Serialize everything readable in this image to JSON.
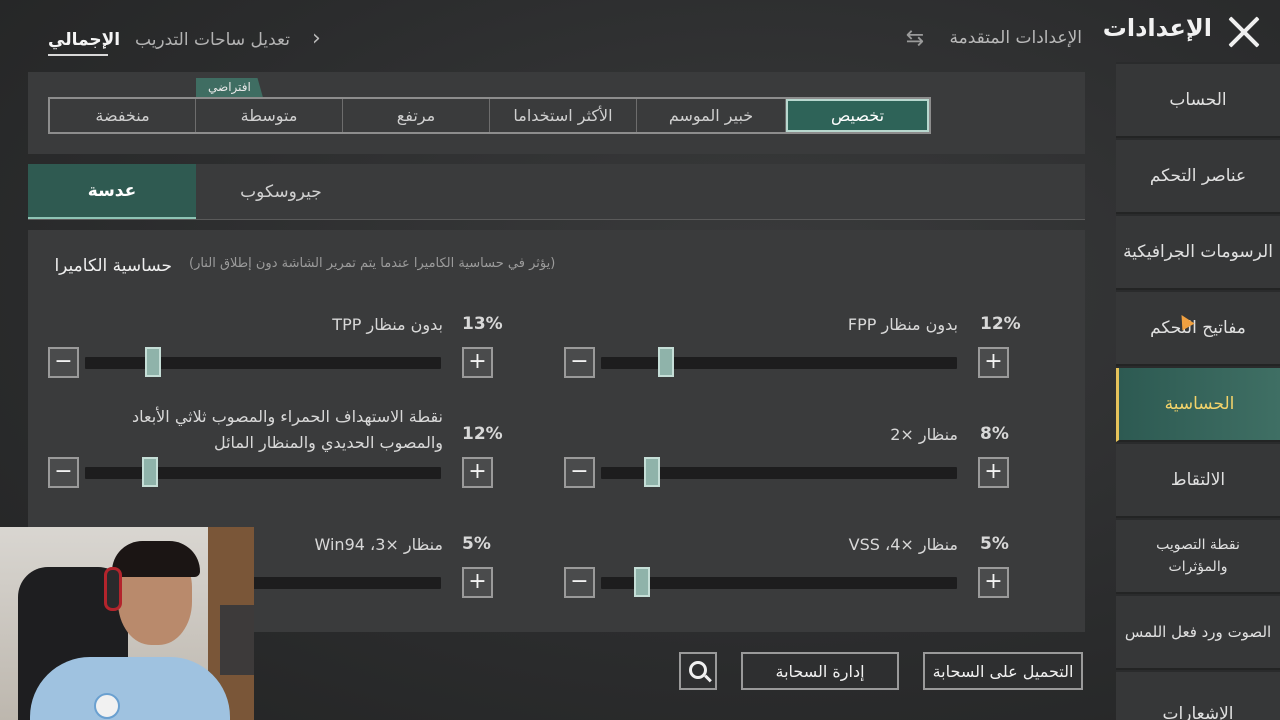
{
  "header": {
    "title": "الإعدادات",
    "advanced_settings": "الإعدادات المتقدمة",
    "breadcrumb_total": "الإجمالي",
    "breadcrumb_training": "تعديل ساحات التدريب"
  },
  "sidebar": {
    "items": [
      {
        "label": "الحساب"
      },
      {
        "label": "عناصر التحكم"
      },
      {
        "label": "الرسومات الجرافيكية"
      },
      {
        "label": "مفاتيح التحكم"
      },
      {
        "label": "الحساسية"
      },
      {
        "label": "الالتقاط"
      },
      {
        "label": "نقطة التصويب والمؤثرات"
      },
      {
        "label": "الصوت ورد فعل اللمس"
      },
      {
        "label": "الإشعارات"
      }
    ],
    "active_index": 4
  },
  "presets": {
    "default_tag": "افتراضي",
    "items": [
      {
        "label": "منخفضة"
      },
      {
        "label": "متوسطة"
      },
      {
        "label": "مرتفع"
      },
      {
        "label": "الأكثر استخداما"
      },
      {
        "label": "خبير الموسم"
      },
      {
        "label": "تخصيص"
      }
    ],
    "selected": "تخصيص"
  },
  "tabs": {
    "lens": "عدسة",
    "gyroscope": "جيروسكوب",
    "active": "عدسة"
  },
  "camera_sensitivity": {
    "title": "حساسية الكاميرا",
    "note": "(يؤثر في حساسية الكاميرا عندما يتم تمرير الشاشة دون إطلاق النار)",
    "sliders": [
      {
        "label": "بدون منظار FPP",
        "value_text": "12%",
        "value": 12
      },
      {
        "label": "بدون منظار TPP",
        "value_text": "13%",
        "value": 13
      },
      {
        "label": "منظار ×2",
        "value_text": "8%",
        "value": 8
      },
      {
        "label": "نقطة الاستهداف الحمراء والمصوب ثلاثي الأبعاد والمصوب الحديدي والمنظار المائل",
        "value_text": "12%",
        "value": 12
      },
      {
        "label": "منظار ×4، VSS",
        "value_text": "5%",
        "value": 5
      },
      {
        "label": "منظار ×3، Win94",
        "value_text": "5%",
        "value": 5
      }
    ],
    "minus": "−",
    "plus": "+"
  },
  "footer": {
    "cloud_upload": "التحميل على السحابة",
    "cloud_manage": "إدارة السحابة"
  },
  "icons": {
    "close": "close-icon",
    "swap": "swap-icon",
    "chevron": "chevron-right-icon",
    "search": "search-icon"
  },
  "colors": {
    "accent": "#2e6358",
    "active_text": "#f3d36a"
  }
}
